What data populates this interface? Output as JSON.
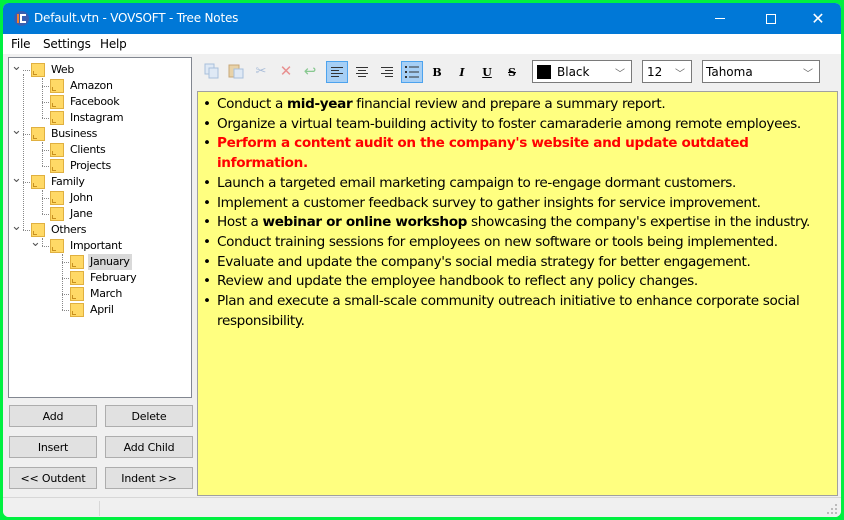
{
  "window": {
    "title": "Default.vtn - VOVSOFT - Tree Notes",
    "controls": {
      "minimize": "minimize",
      "maximize": "maximize",
      "close": "close"
    }
  },
  "menu": [
    "File",
    "Settings",
    "Help"
  ],
  "tree": {
    "nodes": [
      {
        "label": "Web",
        "level": 0,
        "expanded": true
      },
      {
        "label": "Amazon",
        "level": 1
      },
      {
        "label": "Facebook",
        "level": 1
      },
      {
        "label": "Instagram",
        "level": 1
      },
      {
        "label": "Business",
        "level": 0,
        "expanded": true
      },
      {
        "label": "Clients",
        "level": 1
      },
      {
        "label": "Projects",
        "level": 1
      },
      {
        "label": "Family",
        "level": 0,
        "expanded": true
      },
      {
        "label": "John",
        "level": 1
      },
      {
        "label": "Jane",
        "level": 1
      },
      {
        "label": "Others",
        "level": 0,
        "expanded": true
      },
      {
        "label": "Important",
        "level": 1,
        "expanded": true
      },
      {
        "label": "January",
        "level": 2,
        "selected": true
      },
      {
        "label": "February",
        "level": 2
      },
      {
        "label": "March",
        "level": 2
      },
      {
        "label": "April",
        "level": 2
      }
    ]
  },
  "buttons": {
    "add": "Add",
    "delete": "Delete",
    "insert": "Insert",
    "add_child": "Add Child",
    "outdent": "<< Outdent",
    "indent": "Indent >>"
  },
  "toolbar": {
    "icons": [
      "copy",
      "paste",
      "cut",
      "delete",
      "undo",
      "align-left",
      "align-center",
      "align-right",
      "bullets",
      "bold",
      "italic",
      "underline",
      "strikethrough"
    ],
    "active": [
      "align-left",
      "bullets"
    ],
    "bold_label": "B",
    "italic_label": "I",
    "underline_label": "U",
    "strike_label": "S",
    "color": {
      "value": "Black",
      "swatch": "#000000"
    },
    "size": "12",
    "font": "Tahoma"
  },
  "editor": {
    "background": "#ffff80",
    "items": [
      {
        "parts": [
          {
            "t": "Conduct a "
          },
          {
            "t": "mid-year",
            "b": true
          },
          {
            "t": " financial review and prepare a summary report."
          }
        ]
      },
      {
        "parts": [
          {
            "t": "Organize a virtual team-building activity to foster camaraderie among remote employees."
          }
        ]
      },
      {
        "parts": [
          {
            "t": "Perform a content audit on the company's website and update outdated information.",
            "red": true
          }
        ]
      },
      {
        "parts": [
          {
            "t": "Launch a targeted email marketing campaign to re-engage dormant customers."
          }
        ]
      },
      {
        "parts": [
          {
            "t": "Implement a customer feedback survey to gather insights for service improvement."
          }
        ]
      },
      {
        "parts": [
          {
            "t": "Host a "
          },
          {
            "t": "webinar or online workshop",
            "b": true
          },
          {
            "t": " showcasing the company's expertise in the industry."
          }
        ]
      },
      {
        "parts": [
          {
            "t": "Conduct training sessions for employees on new software or tools being implemented."
          }
        ]
      },
      {
        "parts": [
          {
            "t": "Evaluate and update the company's social media strategy for better engagement."
          }
        ]
      },
      {
        "parts": [
          {
            "t": "Review and update the employee handbook to reflect any policy changes."
          }
        ]
      },
      {
        "parts": [
          {
            "t": "Plan and execute a small-scale community outreach initiative to enhance corporate social responsibility."
          }
        ]
      }
    ],
    "accent_red": "#ff0000"
  }
}
